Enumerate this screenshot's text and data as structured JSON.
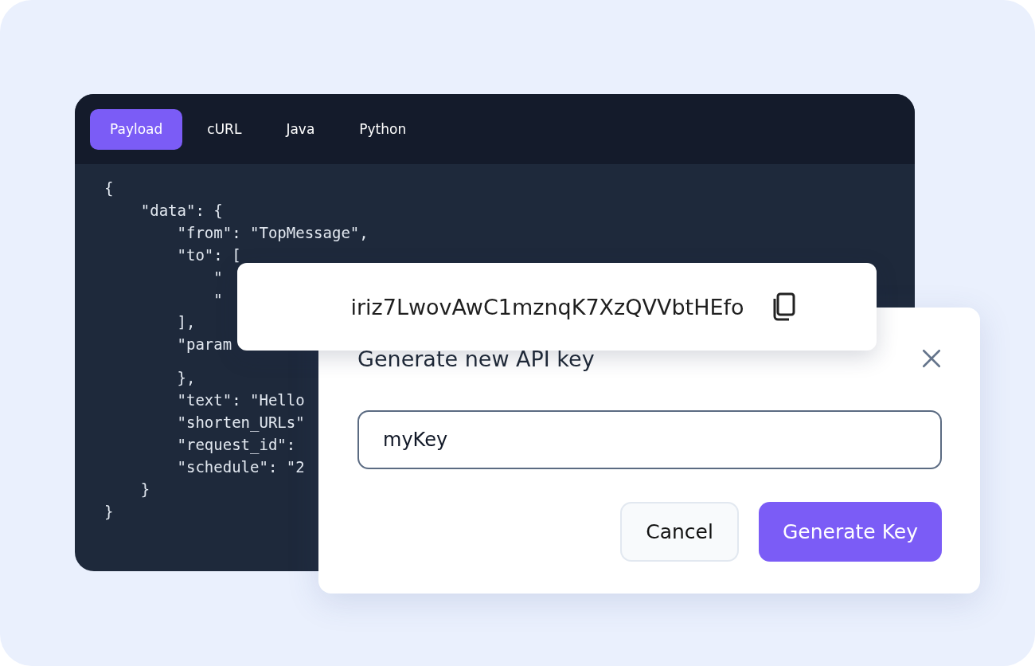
{
  "code_window": {
    "tabs": [
      {
        "label": "Payload",
        "selected": true
      },
      {
        "label": "cURL",
        "selected": false
      },
      {
        "label": "Java",
        "selected": false
      },
      {
        "label": "Python",
        "selected": false
      }
    ],
    "code_lines": [
      "{",
      "    \"data\": {",
      "        \"from\": \"TopMessage\",",
      "        \"to\": [",
      "            \"",
      "            \"",
      "        ],",
      "        \"param",
      "        },",
      "        \"text\": \"Hello",
      "        \"shorten_URLs\"",
      "        \"request_id\":",
      "        \"schedule\": \"2",
      "    }",
      "}"
    ]
  },
  "key_card": {
    "key": "iriz7LwovAwC1mznqK7XzQVVbtHEfo"
  },
  "dialog": {
    "title": "Generate new API key",
    "input_value": "myKey",
    "buttons": [
      {
        "label": "Cancel",
        "kind": "secondary"
      },
      {
        "label": "Generate Key",
        "kind": "primary"
      }
    ]
  }
}
